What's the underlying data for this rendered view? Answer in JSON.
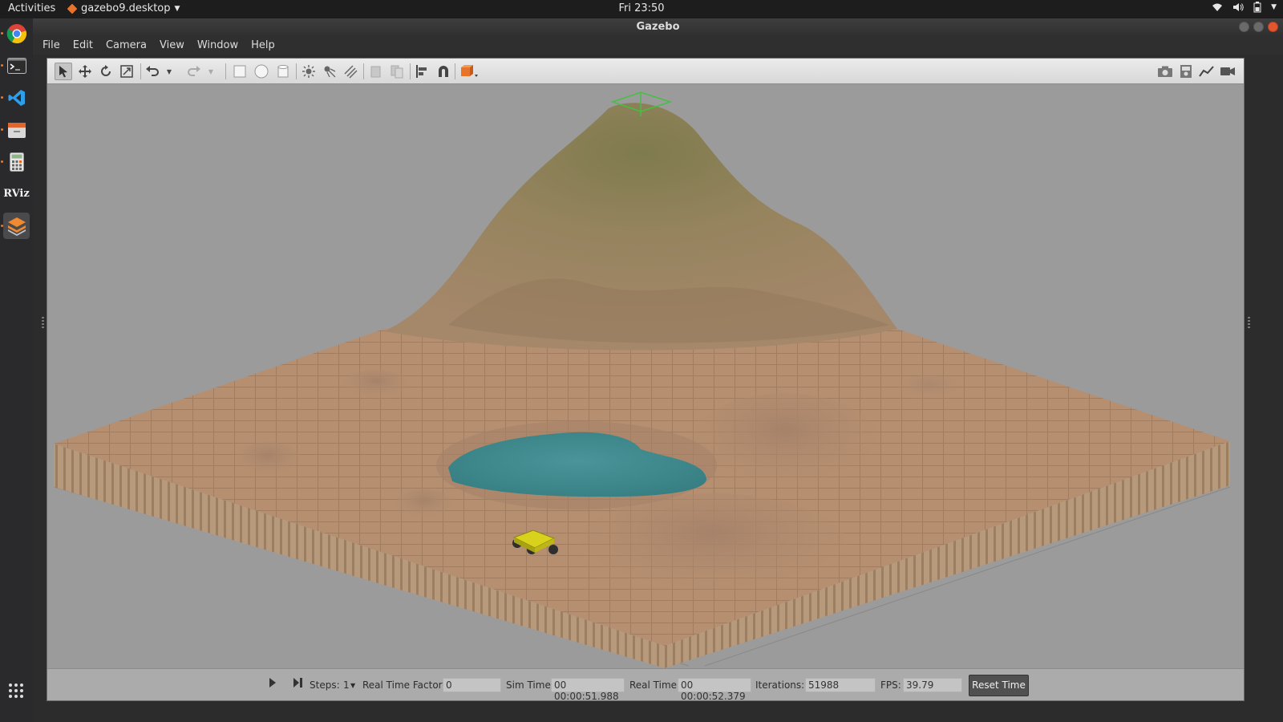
{
  "topbar": {
    "activities": "Activities",
    "app_menu": "gazebo9.desktop",
    "clock": "Fri 23:50"
  },
  "dock": {
    "apps": [
      "chrome-icon",
      "terminal-icon",
      "vscode-icon",
      "files-icon",
      "calculator-icon",
      "rviz-icon",
      "gazebo-icon"
    ],
    "rviz_label": "RViz"
  },
  "window": {
    "title": "Gazebo"
  },
  "menu": {
    "file": "File",
    "edit": "Edit",
    "camera": "Camera",
    "view": "View",
    "window": "Window",
    "help": "Help"
  },
  "colors": {
    "terrain": "#b08a6a",
    "mountain": "#8a8558",
    "water": "#3f8a8e",
    "robot": "#d8d21c",
    "background": "#9b9b9b",
    "accent": "#e8742a"
  },
  "status": {
    "steps_label": "Steps:",
    "steps_value": "1",
    "rtf_label": "Real Time Factor:",
    "rtf_value": "0",
    "sim_time_label": "Sim Time:",
    "sim_time_value": "00 00:00:51.988",
    "real_time_label": "Real Time:",
    "real_time_value": "00 00:00:52.379",
    "iterations_label": "Iterations:",
    "iterations_value": "51988",
    "fps_label": "FPS:",
    "fps_value": "39.79",
    "reset_label": "Reset Time"
  }
}
